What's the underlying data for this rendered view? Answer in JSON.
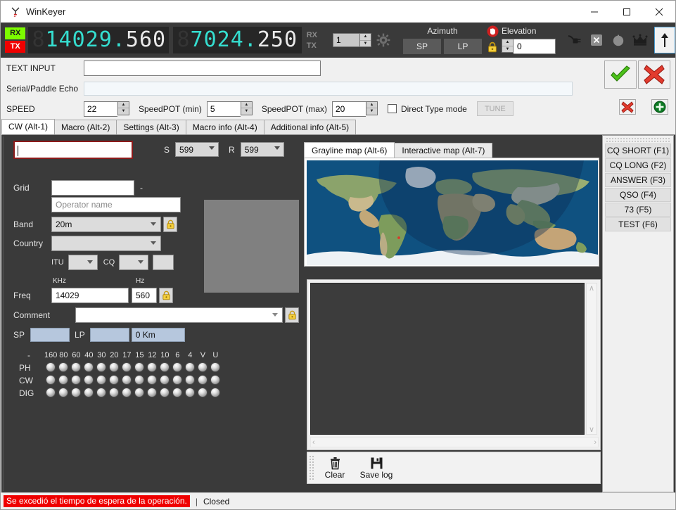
{
  "window": {
    "title": "WinKeyer",
    "app_icon": "antenna-icon",
    "minimize_label": "—",
    "maximize_label": "□",
    "close_label": "✕"
  },
  "radio_bar": {
    "rx_badge": "RX",
    "tx_badge": "TX",
    "vfo_a": {
      "dim_digits": "8",
      "main_digits": "14029",
      "separator": ".",
      "sub_digits": "560"
    },
    "vfo_b": {
      "dim_digits": "8",
      "main_digits": "7024",
      "separator": ".",
      "sub_digits": "250"
    },
    "rx_label": "RX",
    "tx_label": "TX",
    "radio_number": "1",
    "gear_icon": "gear-icon",
    "azimuth": {
      "caption": "Azimuth",
      "sp_label": "SP",
      "lp_label": "LP",
      "lock_icon": "padlock-icon",
      "stop_icon": "stop-hand-icon"
    },
    "elevation": {
      "caption": "Elevation",
      "value": "0"
    },
    "icons": [
      {
        "name": "plug-connect-icon",
        "glyph": "plug"
      },
      {
        "name": "disconnect-x-icon",
        "glyph": "x-box"
      },
      {
        "name": "rotor-knob-icon",
        "glyph": "knob"
      },
      {
        "name": "crown-icon",
        "glyph": "crown"
      },
      {
        "name": "up-arrow-icon",
        "glyph": "↑",
        "selected": true
      }
    ]
  },
  "form": {
    "text_input_label": "TEXT INPUT",
    "text_input_value": "",
    "serial_echo_label": "Serial/Paddle Echo",
    "serial_echo_value": "",
    "speed_label": "SPEED",
    "speed_value": "22",
    "speedpot_min_label": "SpeedPOT (min)",
    "speedpot_min_value": "5",
    "speedpot_max_label": "SpeedPOT (max)",
    "speedpot_max_value": "20",
    "direct_type_label": "Direct Type mode",
    "direct_type_checked": false,
    "tune_label": "TUNE",
    "tune_enabled": false,
    "ok_icon": "green-check-icon",
    "cancel_icon": "red-x-icon",
    "small_delete_icon": "red-x-small-icon",
    "small_add_icon": "green-plus-icon"
  },
  "main_tabs": [
    {
      "label": "CW (Alt-1)",
      "active": true
    },
    {
      "label": "Macro (Alt-2)",
      "active": false
    },
    {
      "label": "Settings (Alt-3)",
      "active": false
    },
    {
      "label": "Macro info (Alt-4)",
      "active": false
    },
    {
      "label": "Additional info (Alt-5)",
      "active": false
    }
  ],
  "qso": {
    "callsign_value": "",
    "sent_label": "S",
    "sent_value": "599",
    "received_label": "R",
    "received_value": "599",
    "grid_label": "Grid",
    "grid_value": "",
    "grid_dash": "-",
    "grid_sub_value": "",
    "operator_placeholder": "Operator name",
    "operator_value": "",
    "band_label": "Band",
    "band_value": "20m",
    "band_lock_icon": "padlock-icon",
    "country_label": "Country",
    "country_value": "",
    "itu_label": "ITU",
    "itu_value": "",
    "cq_label": "CQ",
    "cq_value": "",
    "zone_extra_value": "",
    "freq_label": "Freq",
    "freq_khz_caption": "KHz",
    "freq_khz_value": "14029",
    "freq_hz_caption": "Hz",
    "freq_hz_value": "560",
    "freq_lock_icon": "padlock-icon",
    "comment_label": "Comment",
    "comment_value": "",
    "comment_lock_icon": "padlock-icon",
    "sp_label": "SP",
    "sp_value": "",
    "lp_label": "LP",
    "lp_value": "",
    "distance_value": "0 Km"
  },
  "band_matrix": {
    "corner_label": "-",
    "columns": [
      "160",
      "80",
      "60",
      "40",
      "30",
      "20",
      "17",
      "15",
      "12",
      "10",
      "6",
      "4",
      "V",
      "U"
    ],
    "rows": [
      {
        "label": "PH",
        "states": [
          0,
          0,
          0,
          0,
          0,
          0,
          0,
          0,
          0,
          0,
          0,
          0,
          0,
          0
        ]
      },
      {
        "label": "CW",
        "states": [
          0,
          0,
          0,
          0,
          0,
          0,
          0,
          0,
          0,
          0,
          0,
          0,
          0,
          0
        ]
      },
      {
        "label": "DIG",
        "states": [
          0,
          0,
          0,
          0,
          0,
          0,
          0,
          0,
          0,
          0,
          0,
          0,
          0,
          0
        ]
      }
    ]
  },
  "map": {
    "tabs": [
      {
        "label": "Grayline map (Alt-6)",
        "active": true
      },
      {
        "label": "Interactive map (Alt-7)",
        "active": false
      }
    ],
    "ocean_color": "#0f4f7f",
    "land_color": "#8aa06a",
    "ice_color": "#f2f4f6",
    "night_overlay_color": "rgba(10,40,80,0.38)",
    "station_marker_color": "#d83b2a"
  },
  "log_panel": {
    "content": "",
    "clear_label": "Clear",
    "clear_icon": "trash-icon",
    "save_label": "Save log",
    "save_icon": "floppy-disk-icon",
    "scroll_up_glyph": "∧",
    "scroll_down_glyph": "∨",
    "scroll_left_glyph": "‹",
    "scroll_right_glyph": "›"
  },
  "macro_buttons": [
    {
      "label": "CQ SHORT (F1)"
    },
    {
      "label": "CQ LONG (F2)"
    },
    {
      "label": "ANSWER (F3)"
    },
    {
      "label": "QSO (F4)"
    },
    {
      "label": "73 (F5)"
    },
    {
      "label": "TEST (F6)"
    }
  ],
  "status_bar": {
    "error_text": "Se excedió el tiempo de espera de la operación.",
    "error_color": "#ef0000",
    "separator": "|",
    "state_text": "Closed"
  }
}
